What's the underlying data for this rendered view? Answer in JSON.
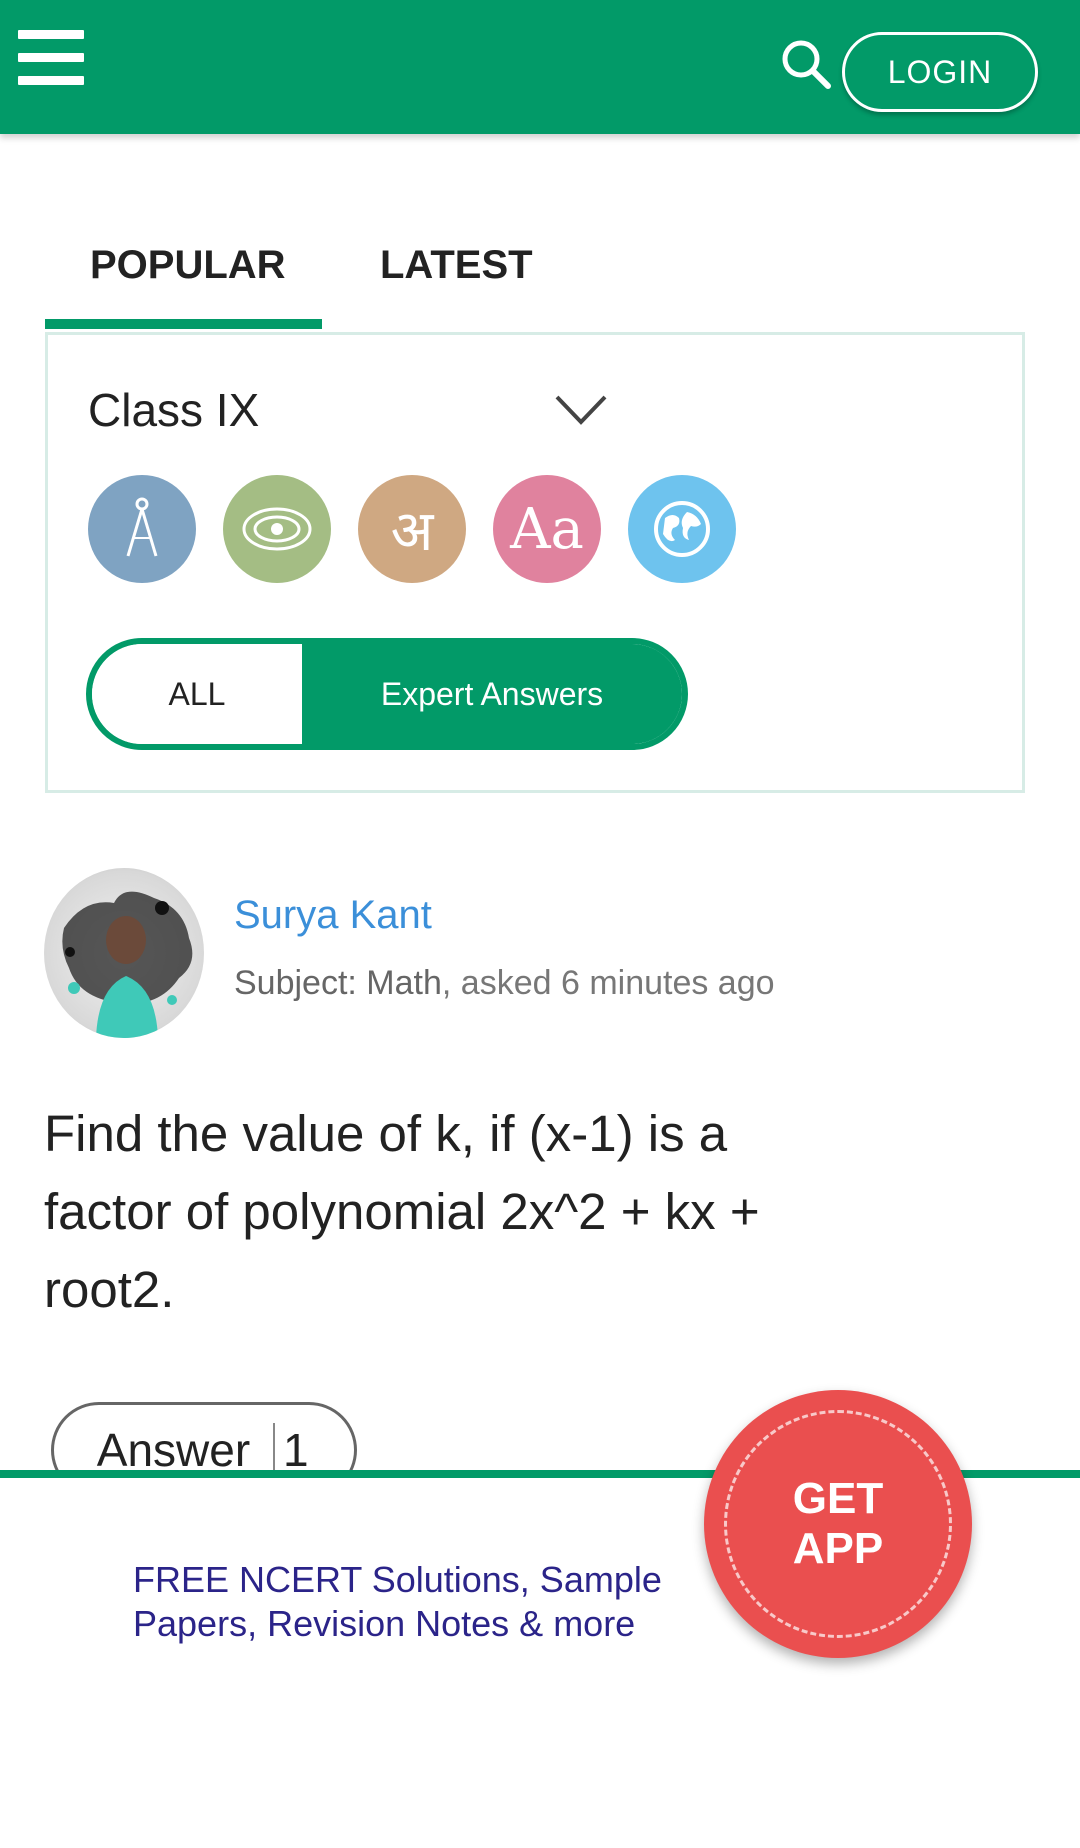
{
  "header": {
    "menu_icon": "hamburger-menu-icon",
    "search_icon": "search-icon",
    "login_label": "LOGIN",
    "background_color": "#029a68"
  },
  "tabs": [
    {
      "label": "POPULAR",
      "active": true
    },
    {
      "label": "LATEST",
      "active": false
    }
  ],
  "filter": {
    "class_value": "Class IX",
    "subjects": [
      {
        "icon": "compass-icon",
        "color": "#7fa3c2"
      },
      {
        "icon": "atom-icon",
        "color": "#a4bd84"
      },
      {
        "icon": "hindi-letter-icon",
        "glyph": "अ",
        "color": "#cfa882"
      },
      {
        "icon": "english-letters-icon",
        "glyph": "Aa",
        "color": "#e0829e"
      },
      {
        "icon": "globe-icon",
        "color": "#6ec3ee"
      }
    ],
    "toggle": {
      "all_label": "ALL",
      "expert_label": "Expert Answers",
      "selected": "Expert Answers"
    }
  },
  "question_card": {
    "user_name": "Surya Kant",
    "subject_label": "Subject: Math",
    "asked_text": ", asked 6 minutes ago",
    "question": "Find the value of k, if (x-1) is a factor of polynomial 2x^2 + kx + root2.",
    "answer_label": "Answer",
    "answer_count": "1"
  },
  "banner": {
    "text": "FREE NCERT Solutions, Sample Papers, Revision Notes & more",
    "get_app_line1": "GET",
    "get_app_line2": "APP"
  },
  "colors": {
    "accent": "#029a68",
    "link": "#3b8fd9",
    "cta": "#ea4f4f"
  }
}
